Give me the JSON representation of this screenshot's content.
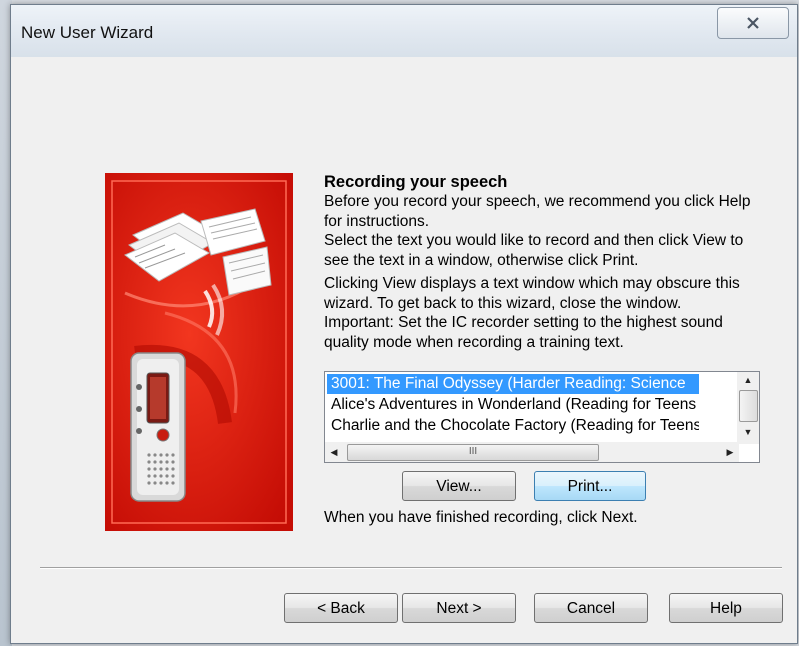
{
  "window": {
    "title": "New User Wizard",
    "close_glyph": "close-icon"
  },
  "content": {
    "heading": "Recording your speech",
    "para1": "Before you record your speech, we recommend you click Help for instructions.",
    "para2": "Select the text you would like to record and then click View to see the text in a window, otherwise click Print.",
    "para3": "Clicking View displays a text window which may obscure this wizard. To get back to this wizard, close the window.",
    "para4": "Important: Set the IC recorder setting to the highest sound quality mode when recording a training text.",
    "finish": "When you have finished recording, click Next."
  },
  "listbox": {
    "items": [
      "3001: The Final Odyssey (Harder Reading: Science",
      "Alice's Adventures in Wonderland (Reading for Teens",
      "Charlie and the Chocolate Factory (Reading for Teens"
    ],
    "selected_index": 0,
    "hscroll_thumb_label": "III"
  },
  "buttons": {
    "view": "View...",
    "print": "Print...",
    "back": "< Back",
    "next": "Next >",
    "cancel": "Cancel",
    "help": "Help"
  },
  "colors": {
    "banner_red": "#e8180c",
    "selection": "#3399ff"
  }
}
